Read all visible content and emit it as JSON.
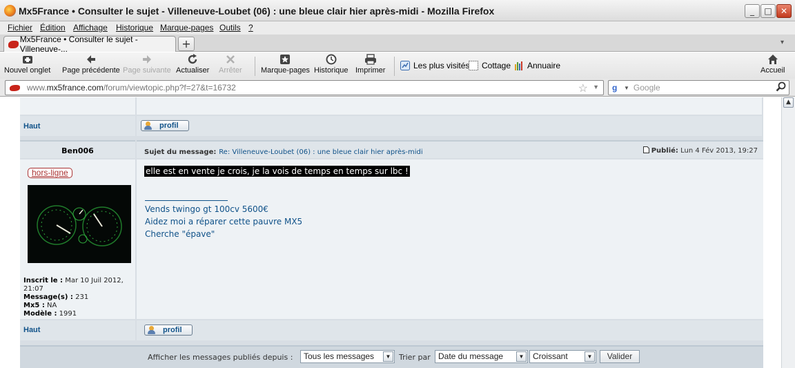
{
  "window": {
    "title": "Mx5France • Consulter le sujet - Villeneuve-Loubet (06) : une bleue clair hier après-midi - Mozilla Firefox",
    "min": "_",
    "max": "□",
    "close": "✕"
  },
  "menu": {
    "items": [
      "Fichier",
      "Édition",
      "Affichage",
      "Historique",
      "Marque-pages",
      "Outils",
      "?"
    ]
  },
  "tab": {
    "label": "Mx5France • Consulter le sujet - Villeneuve-...",
    "new_tab": "+",
    "list_arrow": "▾"
  },
  "toolbar": {
    "new_tab": "Nouvel onglet",
    "back": "Page précédente",
    "forward": "Page suivante",
    "reload": "Actualiser",
    "stop": "Arrêter",
    "bookmarks": "Marque-pages",
    "history": "Historique",
    "print": "Imprimer",
    "home": "Accueil",
    "bm_most_visited": "Les plus visités",
    "bm_cottage": "Cottage",
    "bm_annuaire": "Annuaire"
  },
  "address": {
    "prefix": "www.",
    "host": "mx5france.com",
    "path": "/forum/viewtopic.php?f=27&t=16732",
    "search_placeholder": "Google",
    "search_engine_letter": "g"
  },
  "forum": {
    "haut_label": "Haut",
    "profil_label": "profil",
    "post": {
      "author": "Ben006",
      "status": "hors-ligne",
      "subject_label": "Sujet du message:",
      "subject": "Re: Villeneuve-Loubet (06) : une bleue clair hier après-midi",
      "posted_label": "Publié:",
      "posted_date": "Lun 4 Fév 2013, 19:27",
      "message": "elle est en vente je crois, je la vois de temps en temps sur lbc !",
      "signature": [
        "Vends twingo gt 100cv 5600€",
        "Aidez moi a réparer cette pauvre MX5",
        "Cherche \"épave\""
      ],
      "profile": {
        "joined_label": "Inscrit le :",
        "joined_value": "Mar 10 Juil 2012,",
        "joined_time": "21:07",
        "messages_label": "Message(s) :",
        "messages_value": "231",
        "mx5_label": "Mx5 :",
        "mx5_value": "NA",
        "model_label": "Modèle :",
        "model_value": "1991"
      }
    },
    "filter": {
      "label": "Afficher les messages publiés depuis :",
      "period_value": "Tous les messages",
      "sort_label": "Trier par",
      "sort_value": "Date du message",
      "order_value": "Croissant",
      "submit": "Valider"
    }
  },
  "colors": {
    "link": "#105289",
    "offline_red": "#aa3333",
    "forum_bg": "#d8dee4"
  },
  "icons": {
    "new_tab": "new-tab-icon",
    "back": "arrow-left-icon",
    "forward": "arrow-right-icon",
    "reload": "reload-icon",
    "stop": "stop-x-icon",
    "bookmarks": "bookmark-star-icon",
    "history": "clock-icon",
    "print": "printer-icon",
    "home": "home-icon",
    "star": "star-icon",
    "search": "magnifier-icon",
    "profil": "user-icon",
    "post": "document-icon"
  }
}
